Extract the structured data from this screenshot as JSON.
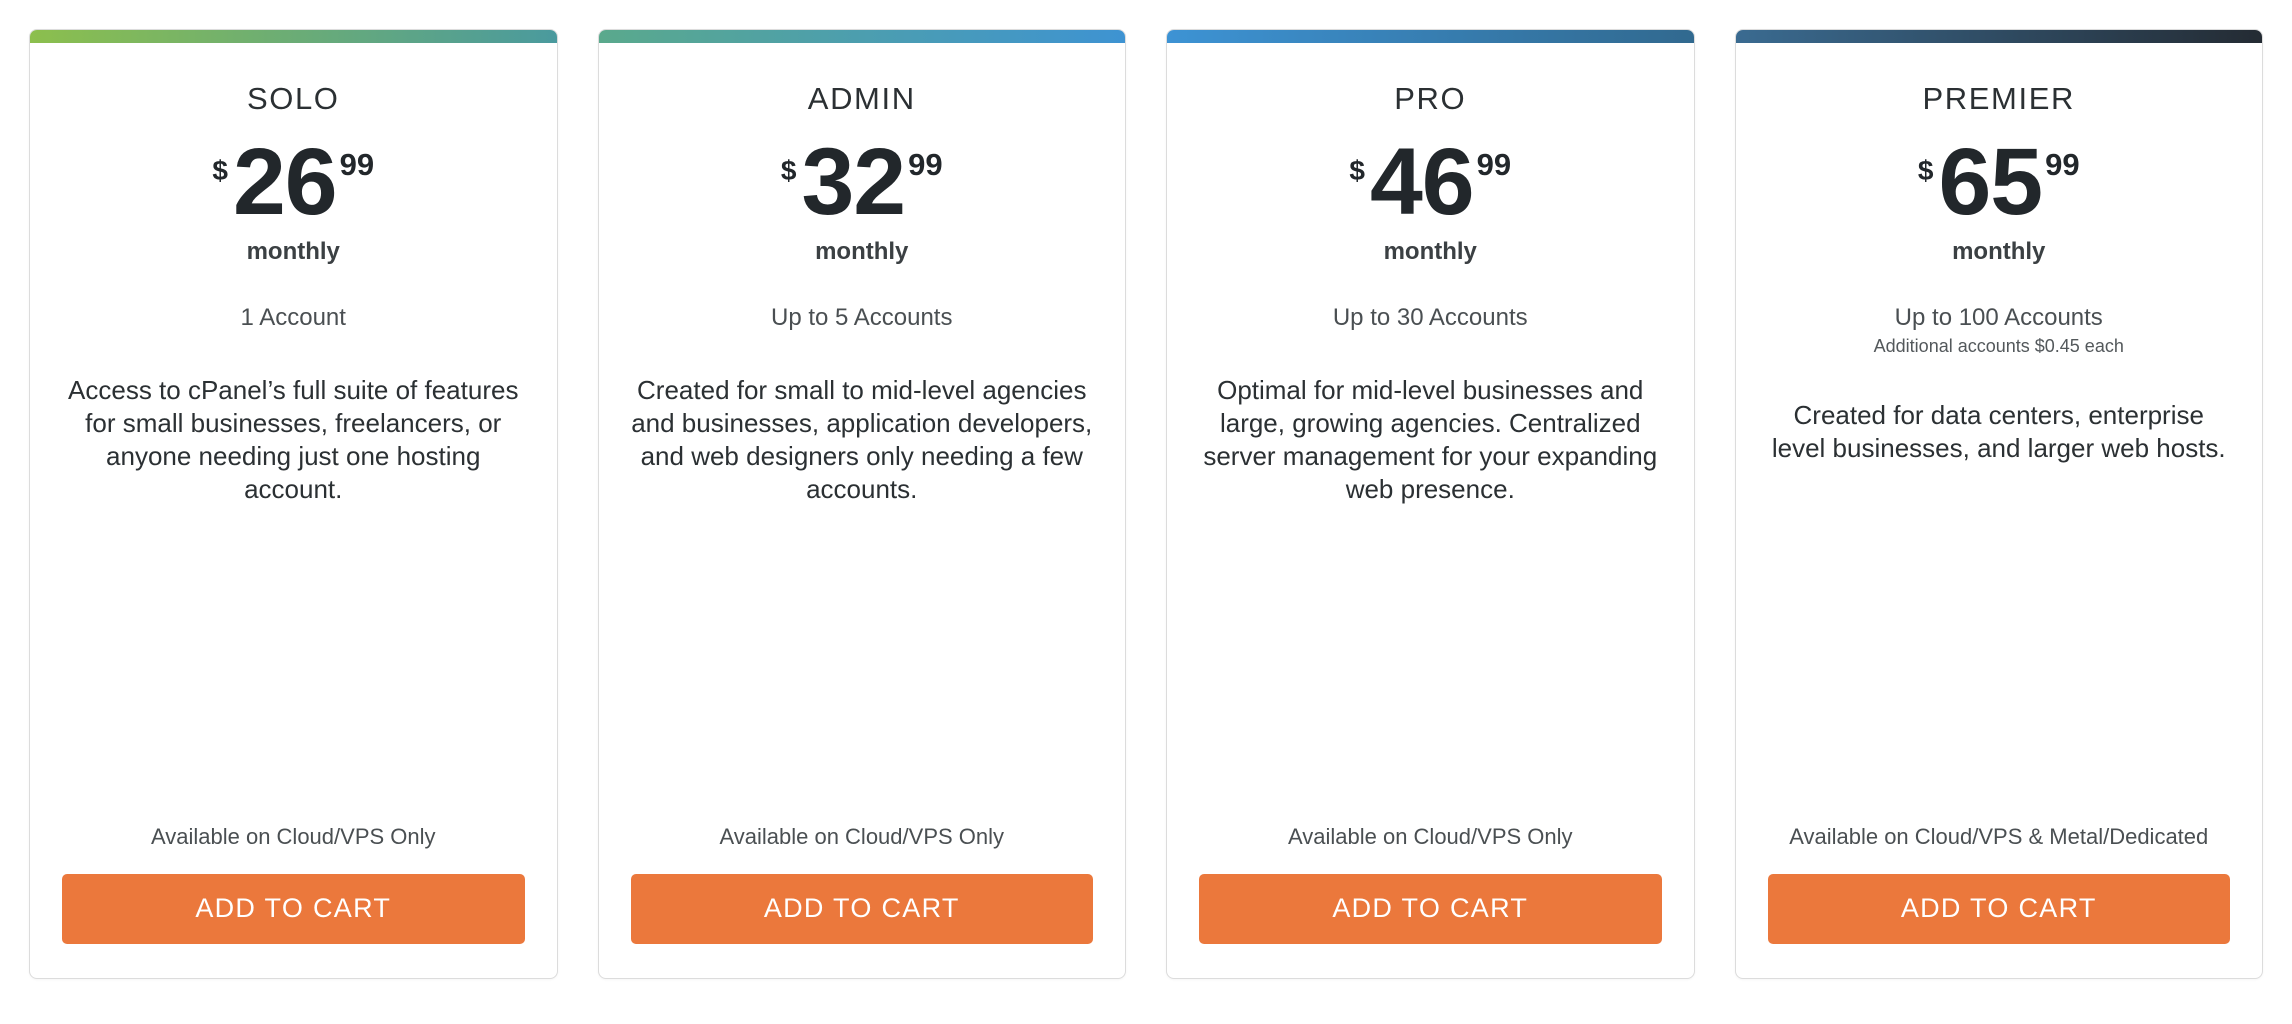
{
  "theme": {
    "cta_color": "#eb783c",
    "card_border_color": "#dcdcdc",
    "text_color": "#2b3033",
    "muted_text_color": "#4a4f52",
    "page_background": "#ffffff"
  },
  "plans": [
    {
      "name": "SOLO",
      "currency": "$",
      "price": "26",
      "cents": "99",
      "period": "monthly",
      "accounts": "1 Account",
      "accounts_note": "",
      "description": "Access to cPanel’s full suite of features for small businesses, freelancers, or anyone needing just one hosting account.",
      "availability": "Available on Cloud/VPS Only",
      "cta_label": "ADD TO CART",
      "accent_start": "#8cbf4d",
      "accent_end": "#4a9a9e"
    },
    {
      "name": "ADMIN",
      "currency": "$",
      "price": "32",
      "cents": "99",
      "period": "monthly",
      "accounts": "Up to 5 Accounts",
      "accounts_note": "",
      "description": "Created for small to mid-level agencies and businesses, application developers, and web designers only needing a few accounts.",
      "availability": "Available on Cloud/VPS Only",
      "cta_label": "ADD TO CART",
      "accent_start": "#5aa98c",
      "accent_end": "#3e93d2"
    },
    {
      "name": "PRO",
      "currency": "$",
      "price": "46",
      "cents": "99",
      "period": "monthly",
      "accounts": "Up to 30 Accounts",
      "accounts_note": "",
      "description": "Optimal for mid-level businesses and large, growing agencies. Centralized server management for your expanding web presence.",
      "availability": "Available on Cloud/VPS Only",
      "cta_label": "ADD TO CART",
      "accent_start": "#3d93d4",
      "accent_end": "#31698f"
    },
    {
      "name": "PREMIER",
      "currency": "$",
      "price": "65",
      "cents": "99",
      "period": "monthly",
      "accounts": "Up to 100 Accounts",
      "accounts_note": "Additional accounts $0.45 each",
      "description": "Created for data centers, enterprise level businesses, and larger web hosts.",
      "availability": "Available on Cloud/VPS & Metal/Dedicated",
      "cta_label": "ADD TO CART",
      "accent_start": "#3a6b91",
      "accent_end": "#242b33"
    }
  ]
}
